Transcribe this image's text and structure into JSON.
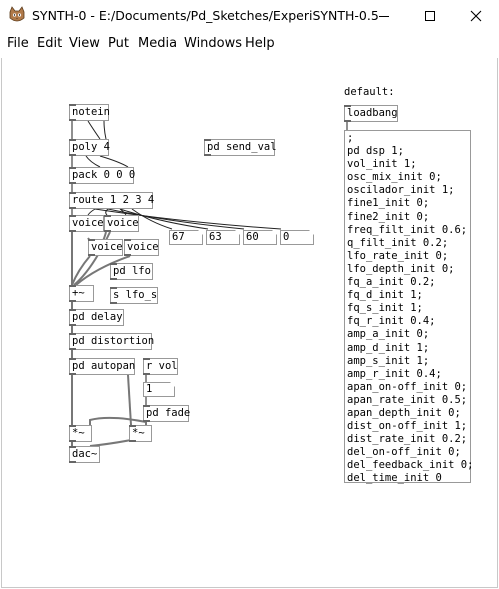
{
  "window": {
    "title": "SYNTH-0  -  E:/Documents/Pd_Sketches/ExperiSYNTH-0.5"
  },
  "menu": [
    "File",
    "Edit",
    "View",
    "Put",
    "Media",
    "Windows",
    "Help"
  ],
  "objects": {
    "notein": "notein",
    "poly": "poly 4",
    "pack": "pack 0 0 0",
    "route": "route 1 2 3 4",
    "voice1": "voice",
    "voice2": "voice",
    "voice3": "voice",
    "voice4": "voice",
    "pd_lfo": "pd lfo",
    "s_lfo": "s lfo_s",
    "add": "+~",
    "pd_delay": "pd delay",
    "pd_distortion": "pd distortion",
    "pd_autopan": "pd autopan",
    "r_vol": "r vol",
    "pd_fade": "pd fade",
    "mul_left": "*~",
    "mul_right": "*~",
    "dac": "dac~",
    "pd_send_val": "pd send_val",
    "loadbang": "loadbang"
  },
  "numbers": {
    "n1": "67",
    "n2": "63",
    "n3": "60",
    "n4": "0",
    "n5": "1"
  },
  "comment_default": "default:",
  "defaults_message": [
    ";",
    "pd dsp 1;",
    "vol_init 1;",
    "osc_mix_init 0;",
    "oscilador_init 1;",
    "fine1_init 0;",
    "fine2_init 0;",
    "freq_filt_init 0.6;",
    "q_filt_init 0.2;",
    "lfo_rate_init 0;",
    "lfo_depth_init 0;",
    "fq_a_init 0.2;",
    "fq_d_init 1;",
    "fq_s_init 1;",
    "fq_r_init 0.4;",
    "amp_a_init 0;",
    "amp_d_init 1;",
    "amp_s_init 1;",
    "amp_r_init 0.4;",
    "apan_on-off_init 0;",
    "apan_rate_init 0.5;",
    "apan_depth_init 0;",
    "dist_on-off_init 1;",
    "dist_rate_init 0.2;",
    "del_on-off_init 0;",
    "del_feedback_init 0;",
    "del_time_init 0"
  ]
}
